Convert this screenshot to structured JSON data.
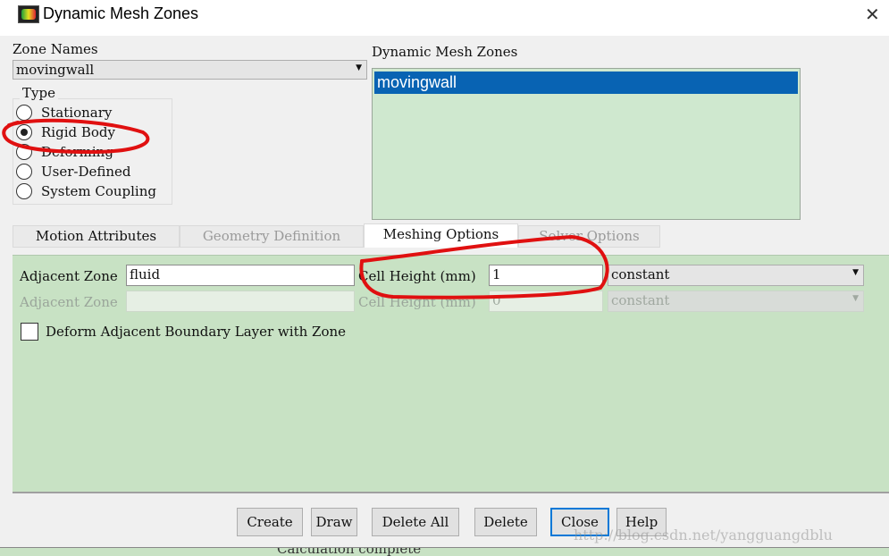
{
  "window": {
    "title": "Dynamic Mesh Zones",
    "icon": "fluent-app-icon",
    "close_icon": "close-icon"
  },
  "zone_names": {
    "label": "Zone Names",
    "value": "movingwall"
  },
  "type": {
    "label": "Type",
    "options": [
      "Stationary",
      "Rigid Body",
      "Deforming",
      "User-Defined",
      "System Coupling"
    ],
    "selected": "Rigid Body"
  },
  "dynamic_zones": {
    "label": "Dynamic Mesh Zones",
    "items": [
      "movingwall"
    ],
    "selected": "movingwall"
  },
  "tabs": [
    {
      "label": "Motion Attributes"
    },
    {
      "label": "Geometry Definition"
    },
    {
      "label": "Meshing Options",
      "active": true
    },
    {
      "label": "Solver Options"
    }
  ],
  "meshing": {
    "row1": {
      "adjacent_label": "Adjacent Zone",
      "adjacent_value": "fluid",
      "cell_label": "Cell Height (mm)",
      "cell_value": "1",
      "method": "constant"
    },
    "row2": {
      "adjacent_label": "Adjacent Zone",
      "adjacent_value": "",
      "cell_label": "Cell Height (mm)",
      "cell_value": "0",
      "method": "constant",
      "disabled": true
    },
    "deform_checkbox": {
      "label": "Deform Adjacent Boundary Layer with Zone",
      "checked": false
    }
  },
  "buttons": [
    "Create",
    "Draw",
    "Delete All",
    "Delete",
    "Close",
    "Help"
  ],
  "status_text": "Calculation complete",
  "watermark": "http://blog.csdn.net/yangguangdblu",
  "colors": {
    "panel": "#c8e2c4",
    "selection": "#0863b3",
    "annotation": "#e01010"
  }
}
